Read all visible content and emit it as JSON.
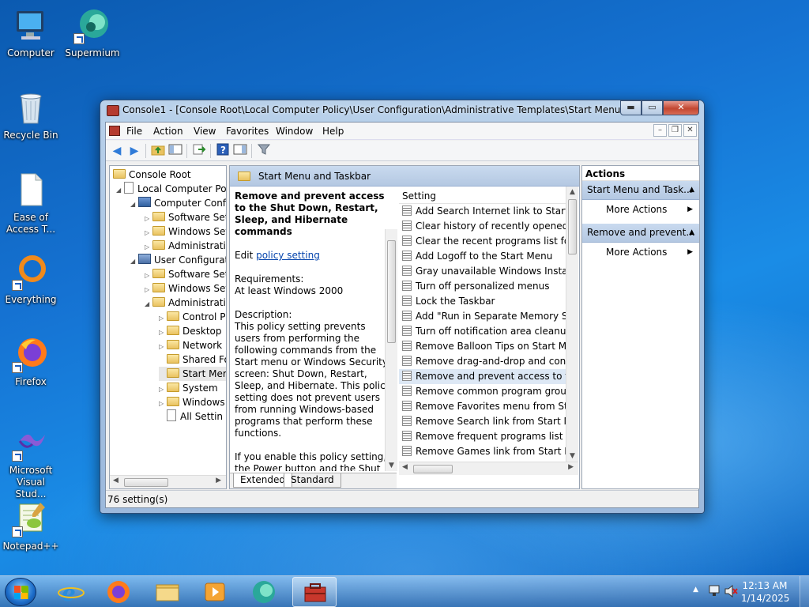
{
  "desktop_icons": [
    {
      "label": "Computer"
    },
    {
      "label": "Supermium"
    },
    {
      "label": "Recycle Bin"
    },
    {
      "label": "Ease of\nAccess T..."
    },
    {
      "label": "Everything"
    },
    {
      "label": "Firefox"
    },
    {
      "label": "Microsoft\nVisual Stud..."
    },
    {
      "label": "Notepad++"
    }
  ],
  "window": {
    "title": "Console1 - [Console Root\\Local Computer Policy\\User Configuration\\Administrative Templates\\Start Menu and Task...",
    "controls": {
      "minimize": "▬",
      "maximize": "▭",
      "close": "✕"
    }
  },
  "menubar": {
    "items": [
      "File",
      "Action",
      "View",
      "Favorites",
      "Window",
      "Help"
    ],
    "mdi": {
      "minimize": "–",
      "restore": "❐",
      "close": "✕"
    }
  },
  "tree": {
    "nodes": [
      {
        "label": "Console Root"
      },
      {
        "label": "Local Computer Pol"
      },
      {
        "label": "Computer Confi"
      },
      {
        "label": "Software Sett"
      },
      {
        "label": "Windows Set"
      },
      {
        "label": "Administrativ"
      },
      {
        "label": "User Configurati"
      },
      {
        "label": "Software Set"
      },
      {
        "label": "Windows Set"
      },
      {
        "label": "Administrativ"
      },
      {
        "label": "Control P"
      },
      {
        "label": "Desktop"
      },
      {
        "label": "Network"
      },
      {
        "label": "Shared Fo"
      },
      {
        "label": "Start Mer"
      },
      {
        "label": "System"
      },
      {
        "label": "Windows"
      },
      {
        "label": "All Settin"
      }
    ]
  },
  "middle": {
    "header": "Start Menu and Taskbar",
    "description": {
      "title": "Remove and prevent access to the Shut Down, Restart, Sleep, and Hibernate commands",
      "edit_prefix": "Edit",
      "edit_link": "policy setting",
      "requirements_label": "Requirements:",
      "requirements_value": "At least Windows 2000",
      "description_label": "Description:",
      "description_text": "This policy setting prevents users from performing the following commands from the Start menu or Windows Security screen: Shut Down, Restart, Sleep, and Hibernate. This policy setting does not prevent users from running Windows-based programs that perform these functions.",
      "enable_text": "If you enable this policy setting, the Power button and the Shut Down, Restart, Sleep, and Hibernate commands are"
    },
    "column_header": "Setting",
    "settings": [
      "Add Search Internet link to Start Me",
      "Clear history of recently opened doc",
      "Clear the recent programs list for ne",
      "Add Logoff to the Start Menu",
      "Gray unavailable Windows Installer",
      "Turn off personalized menus",
      "Lock the Taskbar",
      "Add \"Run in Separate Memory Spac",
      "Turn off notification area cleanup",
      "Remove Balloon Tips on Start Menu",
      "Remove drag-and-drop and contex",
      "Remove and prevent access to the S",
      "Remove common program groups",
      "Remove Favorites menu from Start",
      "Remove Search link from Start Men",
      "Remove frequent programs list from",
      "Remove Games link from Start Men"
    ],
    "selected_index": 11,
    "tabs": [
      "Extended",
      "Standard"
    ]
  },
  "actions": {
    "title": "Actions",
    "groups": [
      {
        "label": "Start Menu and Task...",
        "item": "More Actions"
      },
      {
        "label": "Remove and prevent...",
        "item": "More Actions"
      }
    ]
  },
  "status": "76 setting(s)",
  "taskbar": {
    "time": "12:13 AM",
    "date": "1/14/2025"
  }
}
